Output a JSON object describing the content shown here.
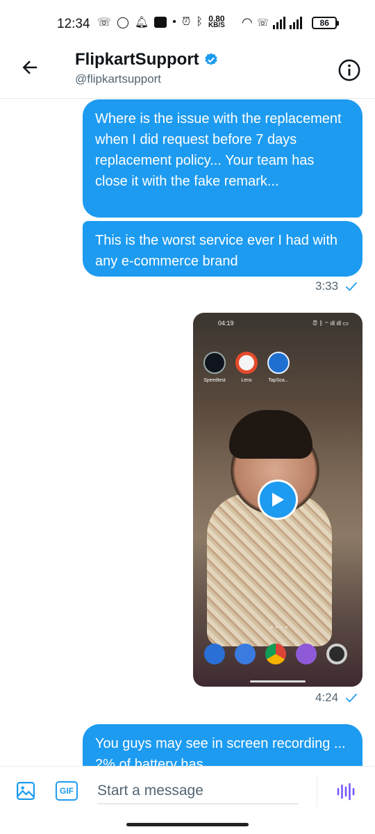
{
  "status_bar": {
    "time": "12:34",
    "net_speed_value": "0.80",
    "net_speed_unit": "KB/S",
    "battery": "86"
  },
  "header": {
    "title": "FlipkartSupport",
    "handle": "@flipkartsupport"
  },
  "messages": [
    {
      "text": "Where is the issue with the replacement when I did request before 7 days replacement policy... Your team has close it with the fake remark..."
    },
    {
      "text": "This is the worst service ever I had with any e-commerce brand",
      "time": "3:33"
    },
    {
      "time": "4:24",
      "media": {
        "status_time": "04:19",
        "apps": [
          "Speedtest",
          "Lens",
          "TapSca..."
        ]
      }
    },
    {
      "text": "You guys may see in screen recording ... 2% of battery has"
    }
  ],
  "composer": {
    "placeholder": "Start a message",
    "gif_label": "GIF"
  },
  "colors": {
    "accent": "#1d9bf0",
    "text_secondary": "#536471"
  }
}
